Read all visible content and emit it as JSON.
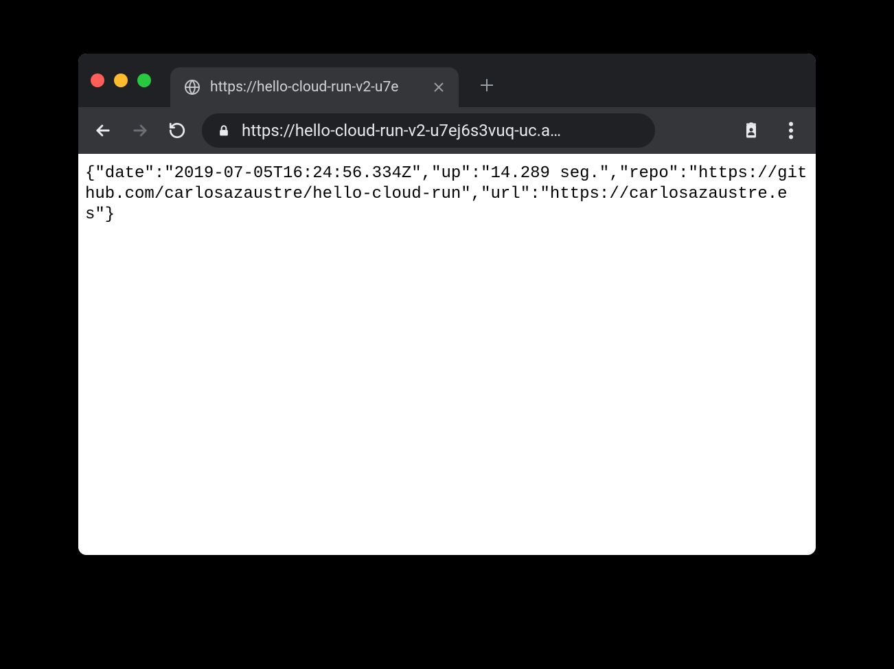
{
  "window": {
    "tab": {
      "title": "https://hello-cloud-run-v2-u7e",
      "favicon": "globe-icon"
    },
    "toolbar": {
      "url_display": "https://hello-cloud-run-v2-u7ej6s3vuq-uc.a…"
    }
  },
  "page": {
    "body_text": "{\"date\":\"2019-07-05T16:24:56.334Z\",\"up\":\"14.289 seg.\",\"repo\":\"https://github.com/carlosazaustre/hello-cloud-run\",\"url\":\"https://carlosazaustre.es\"}"
  }
}
